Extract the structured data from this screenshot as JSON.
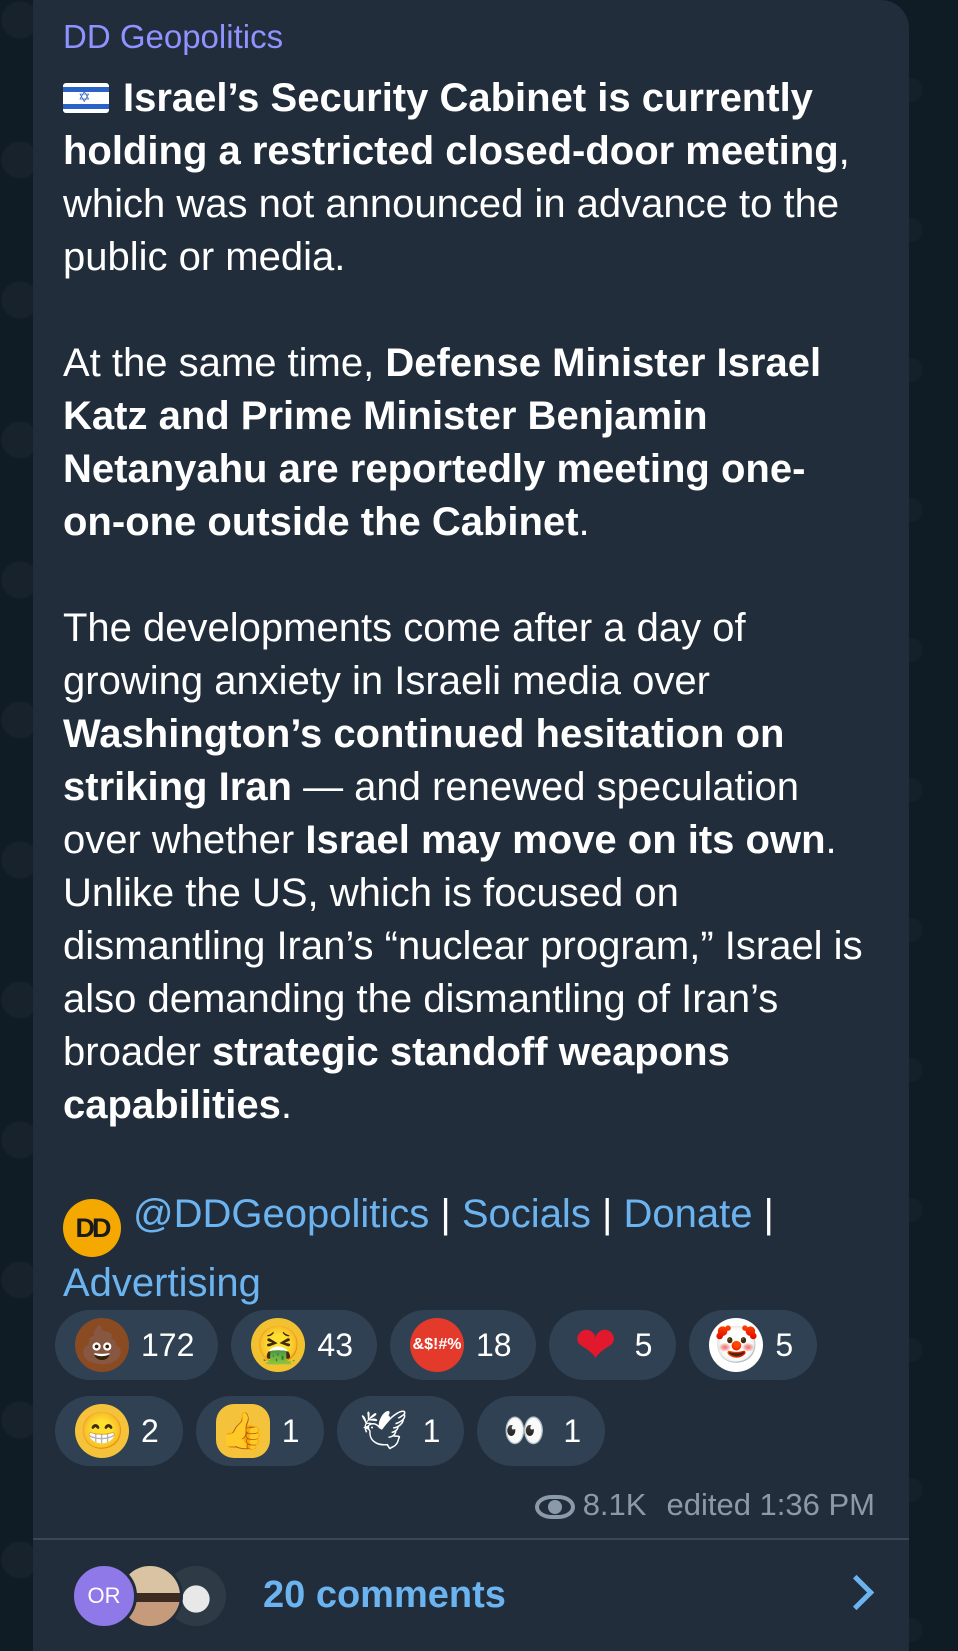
{
  "message": {
    "channel_name": "DD Geopolitics",
    "flag_icon": "israel-flag-icon",
    "p1_bold": "Israel’s Security Cabinet is currently holding a restricted closed-door meeting",
    "p1_rest": ", which was not announced in advance to the public or media.",
    "p2_lead": "At the same time, ",
    "p2_bold": "Defense Minister Israel Katz and Prime Minister Benjamin Netanyahu are reportedly meeting one-on-one outside the Cabinet",
    "p2_end": ".",
    "p3_a": "The developments come after a day of growing anxiety in Israeli media over ",
    "p3_b_bold": "Washington’s continued hesitation on striking Iran",
    "p3_c": " — and renewed speculation over whether ",
    "p3_d_bold": "Israel may move on its own",
    "p3_e": ". Unlike the US, which is focused on dismantling Iran’s “nuclear program,” Israel is also demanding the dismantling of Iran’s broader ",
    "p3_f_bold": "strategic standoff weapons capabilities",
    "p3_g": ".",
    "logo_text": "DD",
    "handle_link": "@DDGeopolitics",
    "sep": " | ",
    "socials_link": "Socials",
    "donate_link": "Donate",
    "advertising_link": "Advertising"
  },
  "reactions": [
    {
      "icon": "poop-emoji-icon",
      "glyph": "💩",
      "count": "172"
    },
    {
      "icon": "vomit-emoji-icon",
      "glyph": "🤮",
      "count": "43"
    },
    {
      "icon": "angry-swearing-emoji-icon",
      "glyph": "&$!#%",
      "count": "18"
    },
    {
      "icon": "heart-emoji-icon",
      "glyph": "❤",
      "count": "5"
    },
    {
      "icon": "clown-emoji-icon",
      "glyph": "🤡",
      "count": "5"
    },
    {
      "icon": "grin-emoji-icon",
      "glyph": "😁",
      "count": "2"
    },
    {
      "icon": "thumbs-up-emoji-icon",
      "glyph": "👍",
      "count": "1"
    },
    {
      "icon": "dove-emoji-icon",
      "glyph": "🕊",
      "count": "1"
    },
    {
      "icon": "eyes-emoji-icon",
      "glyph": "👀",
      "count": "1"
    }
  ],
  "meta": {
    "views": "8.1K",
    "edited": "edited 1:36 PM"
  },
  "comments": {
    "avatar_initials": "OR",
    "label": "20 comments"
  },
  "colors": {
    "bubble": "#212d3b",
    "link": "#6cb4f0",
    "channel_name": "#8f92ff",
    "reaction_pill": "#2f4152"
  }
}
